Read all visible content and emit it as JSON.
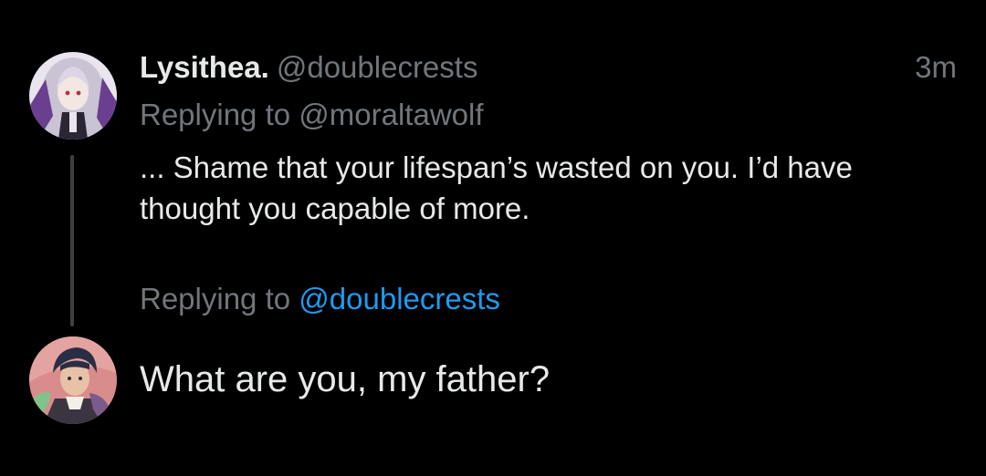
{
  "tweet": {
    "display_name": "Lysithea.",
    "handle": "@doublecrests",
    "timestamp": "3m",
    "replying_prefix": "Replying to",
    "replying_handle": "@moraltawolf",
    "text_line_1": "... Shame that your lifespan’s wasted on you. I’d have",
    "text_line_2": "thought you capable of more."
  },
  "reply": {
    "replying_prefix": "Replying to",
    "replying_handle": "@doublecrests",
    "text": "What are you, my father?"
  },
  "colors": {
    "background": "#000000",
    "primary_text": "#e7e9ea",
    "secondary_text": "#71767b",
    "link": "#1d9bf0",
    "thread_line": "#3e4144"
  }
}
